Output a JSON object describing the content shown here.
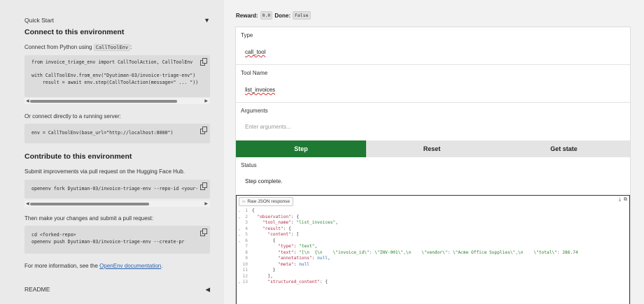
{
  "left": {
    "quick_start": "Quick Start",
    "connect_title": "Connect to this environment",
    "connect_text": "Connect from Python using",
    "connect_code_inline": "CallToolEnv",
    "connect_code_lines": [
      "from invoice_triage_env import CallToolAction, CallToolEnv",
      "",
      "with CallToolEnv.from_env(\"Dyutiman-03/invoice-triage-env\")",
      "    result = await env.step(CallToolAction(message=\" ... \"))"
    ],
    "server_text": "Or connect directly to a running server:",
    "server_code": "env = CallToolEnv(base_url=\"http://localhost:8000\")",
    "contribute_title": "Contribute to this environment",
    "contribute_text": "Submit improvements via pull request on the Hugging Face Hub.",
    "fork_code": "openenv fork Dyutiman-03/invoice-triage-env --repo-id <your-",
    "pr_text": "Then make your changes and submit a pull request:",
    "pr_code_lines": [
      "cd <forked-repo>",
      "openenv push Dyutiman-03/invoice-triage-env --create-pr"
    ],
    "more_info_text": "For more information, see the",
    "more_info_link": "OpenEnv documentation",
    "more_info_end": ".",
    "readme": "README"
  },
  "right": {
    "reward_label": "Reward:",
    "reward_value": "0.0",
    "done_label": "Done:",
    "done_value": "False",
    "type_label": "Type",
    "type_value": "call_tool",
    "tool_name_label": "Tool Name",
    "tool_name_value": "list_invoices",
    "arguments_label": "Arguments",
    "arguments_placeholder": "Enter arguments...",
    "step_button": "Step",
    "reset_button": "Reset",
    "get_state_button": "Get state",
    "status_label": "Status",
    "status_value": "Step complete.",
    "json_tab": "Raw JSON response"
  },
  "json_lines": [
    {
      "n": "1",
      "fold": "⌄",
      "t": "{"
    },
    {
      "n": "2",
      "fold": "⌄",
      "t": "  \"observation\": {"
    },
    {
      "n": "3",
      "fold": "",
      "t": "    \"tool_name\": \"list_invoices\","
    },
    {
      "n": "4",
      "fold": "⌄",
      "t": "    \"result\": {"
    },
    {
      "n": "5",
      "fold": "⌄",
      "t": "      \"content\": ["
    },
    {
      "n": "6",
      "fold": "⌄",
      "t": "        {"
    },
    {
      "n": "7",
      "fold": "",
      "t": "          \"type\": \"text\","
    },
    {
      "n": "8",
      "fold": "",
      "t": "          \"text\": \"[\\n  {\\n    \\\"invoice_id\\\": \\\"INV-001\\\",\\n    \\\"vendor\\\": \\\"Acme Office Supplies\\\",\\n    \\\"total\\\": 286.74"
    },
    {
      "n": "9",
      "fold": "",
      "t": "          \"annotations\": null,"
    },
    {
      "n": "10",
      "fold": "",
      "t": "          \"meta\": null"
    },
    {
      "n": "11",
      "fold": "",
      "t": "        }"
    },
    {
      "n": "12",
      "fold": "",
      "t": "      ],"
    },
    {
      "n": "13",
      "fold": "⌄",
      "t": "      \"structured_content\": {"
    }
  ]
}
